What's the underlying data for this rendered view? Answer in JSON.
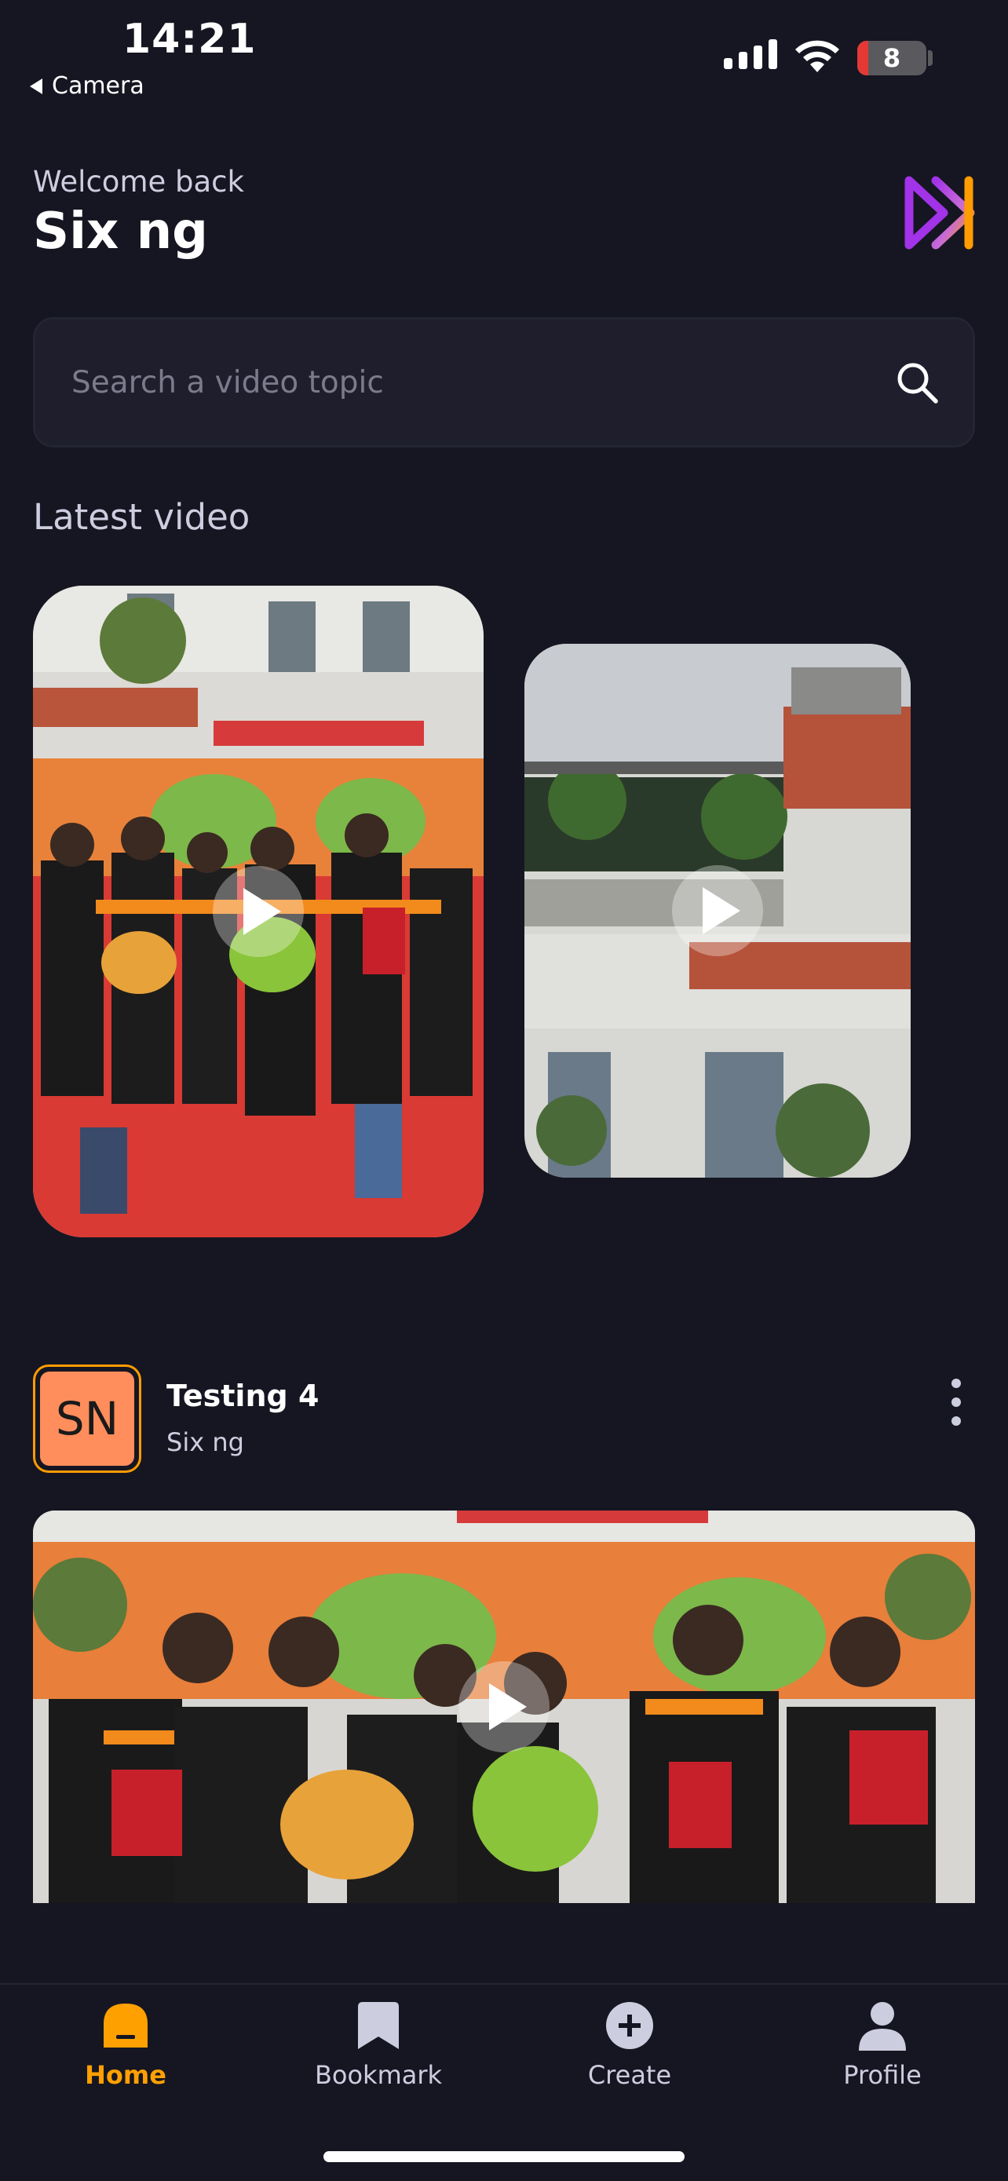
{
  "status_bar": {
    "time": "14:21",
    "back_app": "Camera",
    "battery_level": "8"
  },
  "header": {
    "welcome_text": "Welcome back",
    "username": "Six ng"
  },
  "search": {
    "placeholder": "Search a video topic",
    "value": ""
  },
  "latest": {
    "title": "Latest video",
    "videos": [
      {
        "id": "video-1"
      },
      {
        "id": "video-2"
      }
    ]
  },
  "feed": {
    "posts": [
      {
        "avatar_initials": "SN",
        "title": "Testing 4",
        "author": "Six ng"
      }
    ]
  },
  "tabbar": {
    "items": [
      {
        "label": "Home",
        "icon": "home-icon",
        "active": true
      },
      {
        "label": "Bookmark",
        "icon": "bookmark-icon",
        "active": false
      },
      {
        "label": "Create",
        "icon": "plus-circle-icon",
        "active": false
      },
      {
        "label": "Profile",
        "icon": "profile-icon",
        "active": false
      }
    ]
  },
  "colors": {
    "background": "#161622",
    "accent": "#FF9C01",
    "search_bg": "#1E1E2D",
    "muted_text": "#CDCDE0"
  }
}
